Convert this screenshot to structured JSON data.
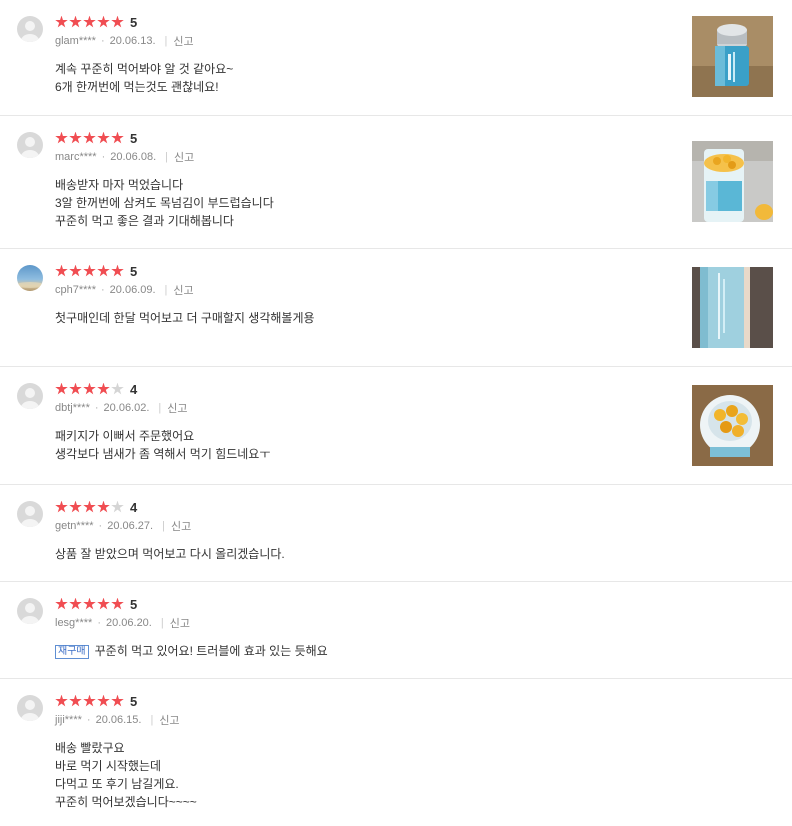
{
  "reviews": [
    {
      "stars": 5,
      "score": "5",
      "user": "glam****",
      "date": "20.06.13.",
      "report": "신고",
      "badge": "",
      "lines": [
        "계속 꾸준히 먹어봐야 알 것 같아요~",
        "6개 한꺼번에 먹는것도 괜찮네요!"
      ],
      "has_photo": true,
      "avatar": "default"
    },
    {
      "stars": 5,
      "score": "5",
      "user": "marc****",
      "date": "20.06.08.",
      "report": "신고",
      "badge": "",
      "lines": [
        "배송받자 마자 먹었습니다",
        "3알 한꺼번에 삼켜도 목넘김이 부드럽습니다",
        "꾸준히 먹고 좋은 결과 기대해봅니다"
      ],
      "has_photo": true,
      "avatar": "default"
    },
    {
      "stars": 5,
      "score": "5",
      "user": "cph7****",
      "date": "20.06.09.",
      "report": "신고",
      "badge": "",
      "lines": [
        "첫구매인데 한달 먹어보고 더 구매할지 생각해볼게용"
      ],
      "has_photo": true,
      "avatar": "photo"
    },
    {
      "stars": 4,
      "score": "4",
      "user": "dbtj****",
      "date": "20.06.02.",
      "report": "신고",
      "badge": "",
      "lines": [
        "패키지가 이뻐서 주문했어요",
        "생각보다 냄새가 좀 역해서 먹기 힘드네요ㅜ"
      ],
      "has_photo": true,
      "avatar": "default"
    },
    {
      "stars": 4,
      "score": "4",
      "user": "getn****",
      "date": "20.06.27.",
      "report": "신고",
      "badge": "",
      "lines": [
        "상품 잘 받았으며 먹어보고 다시 올리겠습니다."
      ],
      "has_photo": false,
      "avatar": "default"
    },
    {
      "stars": 5,
      "score": "5",
      "user": "lesg****",
      "date": "20.06.20.",
      "report": "신고",
      "badge": "재구매",
      "lines": [
        "꾸준히 먹고 있어요! 트러블에 효과 있는 듯해요"
      ],
      "has_photo": false,
      "avatar": "default"
    },
    {
      "stars": 5,
      "score": "5",
      "user": "jiji****",
      "date": "20.06.15.",
      "report": "신고",
      "badge": "",
      "lines": [
        "배송 빨랐구요",
        "바로 먹기 시작했는데",
        "다먹고 또 후기 남길게요.",
        "꾸준히 먹어보겠습니다~~~~"
      ],
      "has_photo": false,
      "avatar": "default"
    }
  ],
  "colors": {
    "star_on": "#f04d52",
    "star_off": "#d5d5d5",
    "badge": "#3d6fc6",
    "divider": "#e7e7e7"
  },
  "icons": {
    "avatar_default": "user-silhouette-icon",
    "star": "star-icon"
  }
}
